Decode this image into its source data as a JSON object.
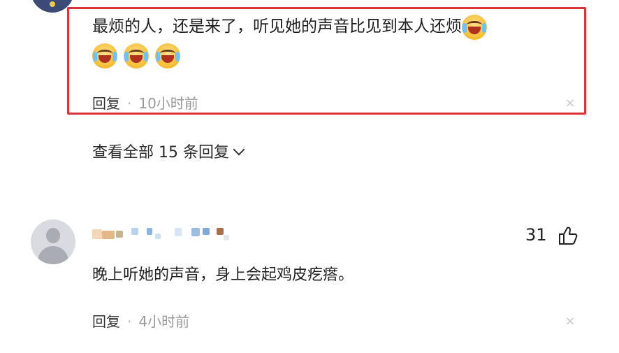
{
  "comment_1": {
    "text": "最烦的人，还是来了，听见她的声音比见到本人还烦",
    "emoji": "laugh-cry-emoji",
    "emoji_count": 4,
    "reply_label": "回复",
    "separator": "·",
    "time": "10小时前",
    "close_glyph": "×",
    "highlight_color": "#d9343a"
  },
  "view_all_replies": "查看全部 15 条回复",
  "comment_2": {
    "likes": "31",
    "text": "晚上听她的声音，身上会起鸡皮疙瘩。",
    "reply_label": "回复",
    "separator": "·",
    "time": "4小时前",
    "close_glyph": "×"
  }
}
